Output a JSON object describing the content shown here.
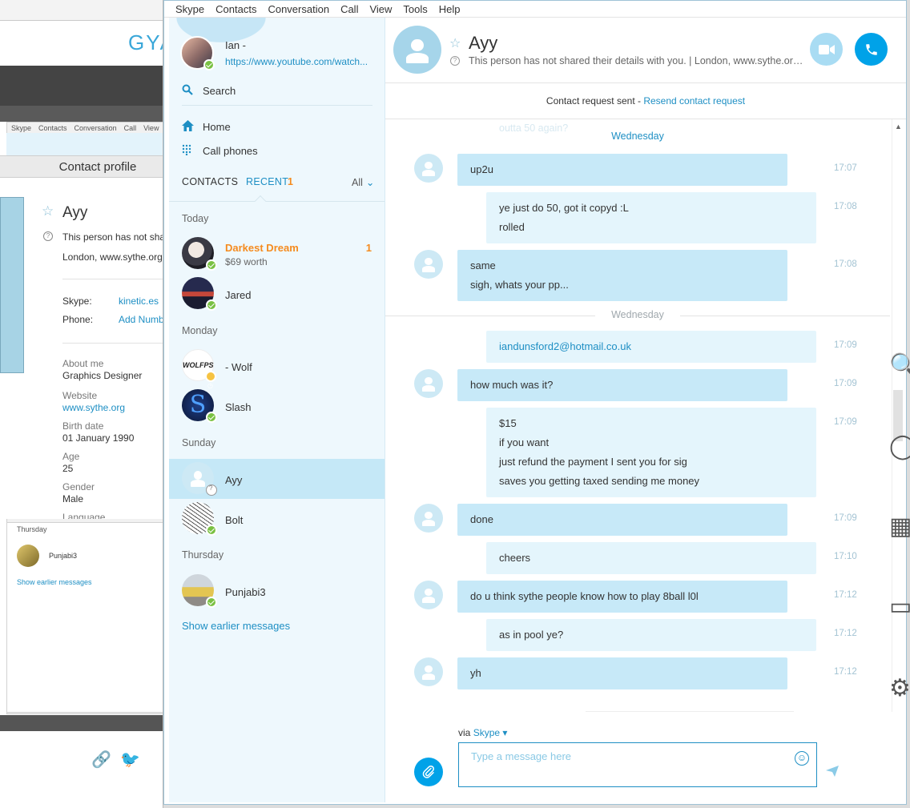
{
  "background_window": {
    "logo": "GYA",
    "skype_menu": [
      "Skype",
      "Contacts",
      "Conversation",
      "Call",
      "View"
    ],
    "contact_profile_title": "Contact profile",
    "name": "Ayy",
    "status_note": "This person has not sha",
    "location": "London, www.sythe.org",
    "skype_label": "Skype:",
    "skype_value": "kinetic.es",
    "phone_label": "Phone:",
    "phone_value": "Add Numb",
    "about_label": "About me",
    "about_value": "Graphics Designer",
    "website_label": "Website",
    "website_value": "www.sythe.org",
    "birth_label": "Birth date",
    "birth_value": "01 January 1990",
    "age_label": "Age",
    "age_value": "25",
    "gender_label": "Gender",
    "gender_value": "Male",
    "language_label": "Language",
    "recent_day": "Thursday",
    "recent_contact": "Punjabi3",
    "show_earlier": "Show earlier messages"
  },
  "menu": [
    "Skype",
    "Contacts",
    "Conversation",
    "Call",
    "View",
    "Tools",
    "Help"
  ],
  "me": {
    "name": "Ian -",
    "mood": "https://www.youtube.com/watch..."
  },
  "nav": {
    "search": "Search",
    "home": "Home",
    "call_phones": "Call phones"
  },
  "tabs": {
    "contacts": "CONTACTS",
    "recent": "RECENT",
    "recent_badge": "1",
    "filter": "All"
  },
  "groups": {
    "today": "Today",
    "monday": "Monday",
    "sunday": "Sunday",
    "thursday": "Thursday"
  },
  "recent": [
    {
      "name": "Darkest Dream",
      "sub": "$69 worth",
      "count": "1"
    },
    {
      "name": "Jared"
    },
    {
      "name": "- Wolf",
      "logo": "WOLFPS"
    },
    {
      "name": "Slash",
      "logo": "S"
    },
    {
      "name": "Ayy"
    },
    {
      "name": "Bolt"
    },
    {
      "name": "Punjabi3"
    }
  ],
  "show_earlier": "Show earlier messages",
  "conversation": {
    "name": "Ayy",
    "description": "This person has not shared their details with you.  |  London, www.sythe.org...",
    "request_text": "Contact request sent - ",
    "request_link": "Resend contact request",
    "faded_top": "outta 50 again?",
    "day1": "Wednesday",
    "day2": "Wednesday",
    "messages": [
      {
        "lines": [
          "up2u"
        ],
        "time": "17:07"
      },
      {
        "lines": [
          "ye just do 50, got it copyd :L",
          "rolled"
        ],
        "time": "17:08"
      },
      {
        "lines": [
          "same",
          "sigh, whats your pp..."
        ],
        "time": "17:08"
      },
      {
        "lines": [
          "iandunsford2@hotmail.co.uk"
        ],
        "time": "17:09"
      },
      {
        "lines": [
          "how much was it?"
        ],
        "time": "17:09"
      },
      {
        "lines": [
          "$15",
          "if you want",
          "just refund the payment I sent you for sig",
          "saves you getting taxed sending me money"
        ],
        "time": "17:09"
      },
      {
        "lines": [
          "done"
        ],
        "time": "17:09"
      },
      {
        "lines": [
          "cheers"
        ],
        "time": "17:10"
      },
      {
        "lines": [
          "do u think sythe people know how to play 8ball l0l"
        ],
        "time": "17:12"
      },
      {
        "lines": [
          "as in pool ye?"
        ],
        "time": "17:12"
      },
      {
        "lines": [
          "yh"
        ],
        "time": "17:12"
      }
    ],
    "via_label": "via ",
    "via_service": "Skype",
    "compose_placeholder": "Type a message here"
  },
  "colors": {
    "accent": "#00a2e8",
    "link": "#1e8fc4",
    "unread": "#f58b1f",
    "online": "#7ac143",
    "bubble_in": "#c7e9f8",
    "bubble_out": "#e4f5fc"
  },
  "icons": [
    "search-icon",
    "home-icon",
    "dialpad-icon",
    "star-icon",
    "question-icon",
    "video-icon",
    "phone-icon",
    "emoji-icon",
    "paperclip-icon",
    "send-icon"
  ]
}
